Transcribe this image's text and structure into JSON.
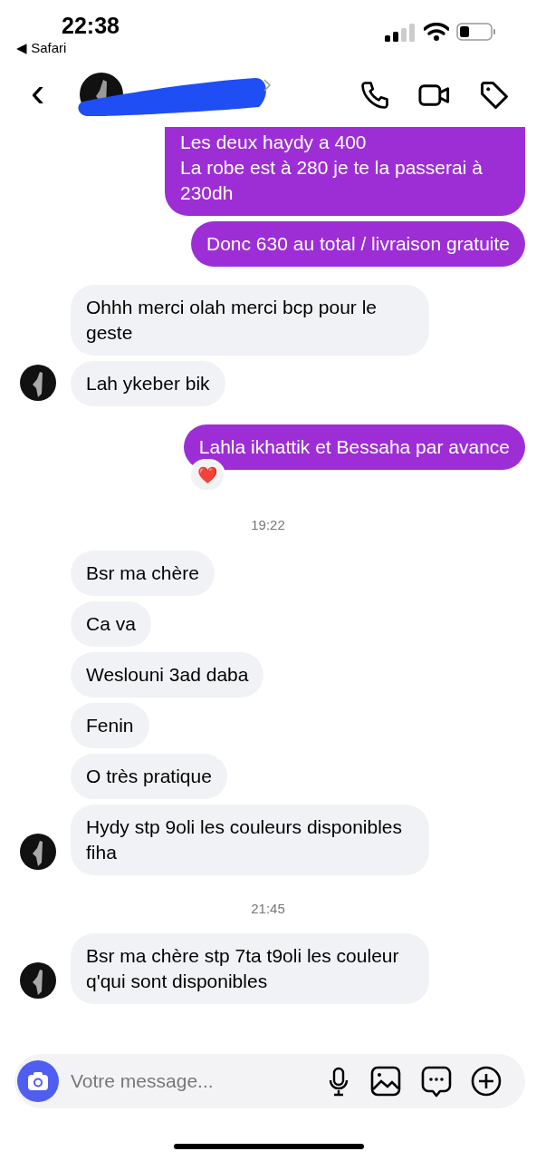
{
  "status_bar": {
    "time": "22:38",
    "back_app": "◀ Safari"
  },
  "header": {
    "back": "‹"
  },
  "messages": [
    {
      "kind": "out",
      "text": "Les deux haydy a 400\nLa robe est à 280 je te la passerai à 230dh",
      "cut_top": true
    },
    {
      "kind": "out",
      "text": "Donc 630 au total / livraison gratuite"
    },
    {
      "kind": "in",
      "text": "Ohhh merci olah merci bcp pour le geste",
      "avatar": false
    },
    {
      "kind": "in",
      "text": "Lah ykeber bik",
      "avatar": true
    },
    {
      "kind": "out",
      "text": "Lahla ikhattik et Bessaha par avance",
      "reaction": "❤️"
    },
    {
      "kind": "time",
      "text": "19:22"
    },
    {
      "kind": "in",
      "text": "Bsr ma chère",
      "avatar": false
    },
    {
      "kind": "in",
      "text": "Ca va",
      "avatar": false
    },
    {
      "kind": "in",
      "text": "Weslouni 3ad daba",
      "avatar": false
    },
    {
      "kind": "in",
      "text": "Fenin",
      "avatar": false
    },
    {
      "kind": "in",
      "text": "O très pratique",
      "avatar": false
    },
    {
      "kind": "in",
      "text": "Hydy stp 9oli les couleurs disponibles fiha",
      "avatar": true
    },
    {
      "kind": "time",
      "text": "21:45"
    },
    {
      "kind": "in",
      "text": "Bsr ma chère stp 7ta t9oli les couleur q'qui sont disponibles",
      "avatar": true
    }
  ],
  "composer": {
    "placeholder": "Votre message..."
  }
}
